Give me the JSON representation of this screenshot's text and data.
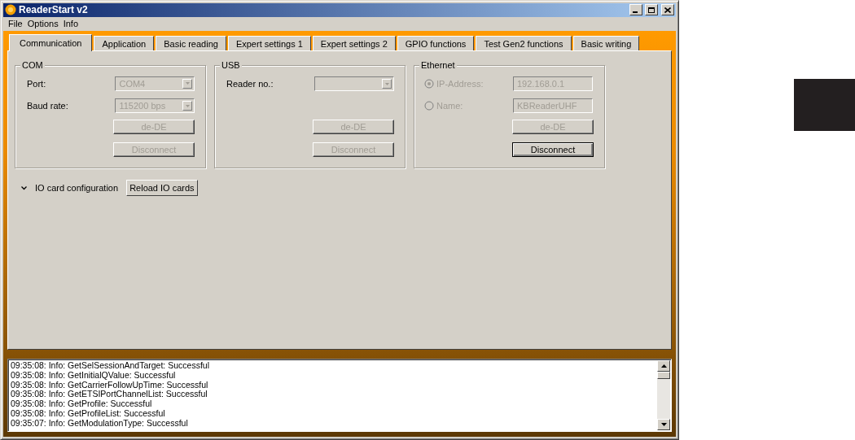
{
  "window": {
    "title": "ReaderStart v2"
  },
  "menu": [
    "File",
    "Options",
    "Info"
  ],
  "tabs": [
    {
      "label": "Communication",
      "selected": true
    },
    {
      "label": "Application",
      "selected": false
    },
    {
      "label": "Basic reading",
      "selected": false
    },
    {
      "label": "Expert settings 1",
      "selected": false
    },
    {
      "label": "Expert settings 2",
      "selected": false
    },
    {
      "label": "GPIO functions",
      "selected": false
    },
    {
      "label": "Test Gen2 functions",
      "selected": false
    },
    {
      "label": "Basic writing",
      "selected": false
    }
  ],
  "groups": [
    {
      "title": "COM",
      "fields": [
        {
          "kind": "combo",
          "label": "Port:",
          "value": "COM4",
          "disabled": true
        },
        {
          "kind": "combo",
          "label": "Baud rate:",
          "value": "115200 bps",
          "disabled": true
        }
      ],
      "buttons": [
        {
          "label": "de-DE",
          "disabled": true
        },
        {
          "label": "Disconnect",
          "disabled": true
        }
      ]
    },
    {
      "title": "USB",
      "fields": [
        {
          "kind": "combo",
          "label": "Reader no.:",
          "disabled": true
        }
      ],
      "buttons": [
        {
          "label": "de-DE",
          "disabled": true
        },
        {
          "label": "Disconnect",
          "disabled": true
        }
      ]
    },
    {
      "title": "Ethernet",
      "fields": [
        {
          "kind": "radio",
          "label": "IP-Address:",
          "value": "192.168.0.1",
          "selected": true,
          "disabled": true
        },
        {
          "kind": "radio",
          "label": "Name:",
          "value": "KBReaderUHF",
          "selected": false,
          "disabled": true
        }
      ],
      "buttons": [
        {
          "label": "de-DE",
          "disabled": true
        },
        {
          "label": "Disconnect",
          "disabled": false
        }
      ]
    }
  ],
  "io": {
    "label": "IO card configuration",
    "button": "Reload IO cards"
  },
  "log": [
    "09:35:08: Info: GetSelSessionAndTarget: Successful",
    "09:35:08: Info: GetInitialQValue: Successful",
    "09:35:08: Info: GetCarrierFollowUpTime: Successful",
    "09:35:08: Info: GetETSIPortChannelList: Successful",
    "09:35:08: Info: GetProfile: Successful",
    "09:35:08: Info: GetProfileList: Successful",
    "09:35:07: Info: GetModulationType: Successful"
  ]
}
